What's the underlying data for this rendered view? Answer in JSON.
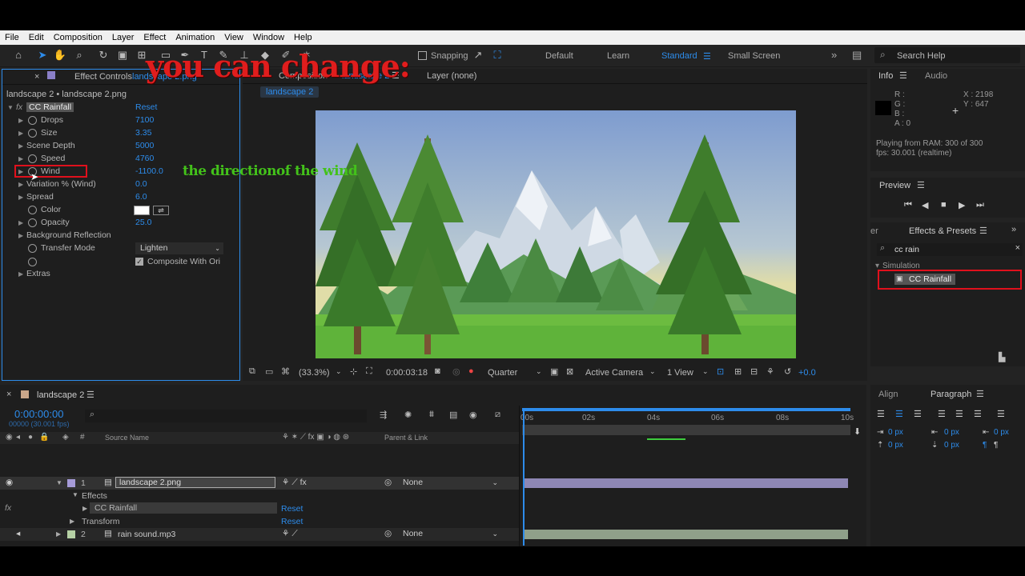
{
  "menu": [
    "File",
    "Edit",
    "Composition",
    "Layer",
    "Effect",
    "Animation",
    "View",
    "Window",
    "Help"
  ],
  "toolbar": {
    "snapping_label": "Snapping",
    "workspaces": [
      "Default",
      "Learn",
      "Standard",
      "Small Screen"
    ],
    "active_workspace": "Standard",
    "search_placeholder": "Search Help"
  },
  "overlay": {
    "title": "you can change:",
    "wind_note": "the directionof the wind"
  },
  "effect_controls": {
    "tab_label": "Effect Controls",
    "tab_comp": "landscape 2.png",
    "header": "landscape 2 • landscape 2.png",
    "effect_name": "CC Rainfall",
    "reset_label": "Reset",
    "properties": [
      {
        "label": "Drops",
        "value": "7100"
      },
      {
        "label": "Size",
        "value": "3.35"
      },
      {
        "label": "Scene Depth",
        "value": "5000"
      },
      {
        "label": "Speed",
        "value": "4760"
      },
      {
        "label": "Wind",
        "value": "-1100.0"
      },
      {
        "label": "Variation % (Wind)",
        "value": "0.0"
      },
      {
        "label": "Spread",
        "value": "6.0"
      },
      {
        "label": "Color",
        "value": ""
      },
      {
        "label": "Opacity",
        "value": "25.0"
      },
      {
        "label": "Background Reflection",
        "value": ""
      },
      {
        "label": "Transfer Mode",
        "value": "Lighten"
      },
      {
        "label": "",
        "value": "Composite With Ori"
      },
      {
        "label": "Extras",
        "value": ""
      }
    ]
  },
  "composition": {
    "tab_label": "Composition",
    "tab_comp": "landscape 2",
    "layer_tab": "Layer (none)",
    "comp_pill": "landscape 2",
    "zoom": "(33.3%)",
    "timecode": "0:00:03:18",
    "resolution": "Quarter",
    "camera": "Active Camera",
    "view": "1 View",
    "exposure": "+0.0"
  },
  "info": {
    "tab_label": "Info",
    "audio_tab": "Audio",
    "r": "R :",
    "g": "G :",
    "b": "B :",
    "a": "A :  0",
    "x": "X : 2198",
    "y": "Y : 647",
    "playing": "Playing from RAM: 300 of 300",
    "fps": "fps: 30.001 (realtime)"
  },
  "preview": {
    "tab_label": "Preview"
  },
  "effects_presets": {
    "tab_prefix": "er",
    "tab_label": "Effects & Presets",
    "search_value": "cc rain",
    "category": "Simulation",
    "result": "CC Rainfall"
  },
  "timeline": {
    "tab_label": "landscape 2",
    "timecode": "0:00:00:00",
    "frame_info": "00000 (30.001 fps)",
    "col_source": "Source Name",
    "col_parent": "Parent & Link",
    "ruler": [
      "00s",
      "02s",
      "04s",
      "06s",
      "08s",
      "10s"
    ],
    "layers": [
      {
        "num": "1",
        "name": "landscape 2.png",
        "parent": "None"
      },
      {
        "num": "2",
        "name": "rain sound.mp3",
        "parent": "None"
      }
    ],
    "effects_label": "Effects",
    "effect_item": "CC Rainfall",
    "transform_label": "Transform",
    "reset_label": "Reset"
  },
  "paragraph": {
    "align_tab": "Align",
    "paragraph_tab": "Paragraph",
    "indent_values": [
      "0 px",
      "0 px",
      "0 px",
      "0 px",
      "0 px"
    ]
  },
  "colors": {
    "accent": "#2d8ceb",
    "highlight": "#e0101c",
    "panel": "#1e1e1e"
  }
}
